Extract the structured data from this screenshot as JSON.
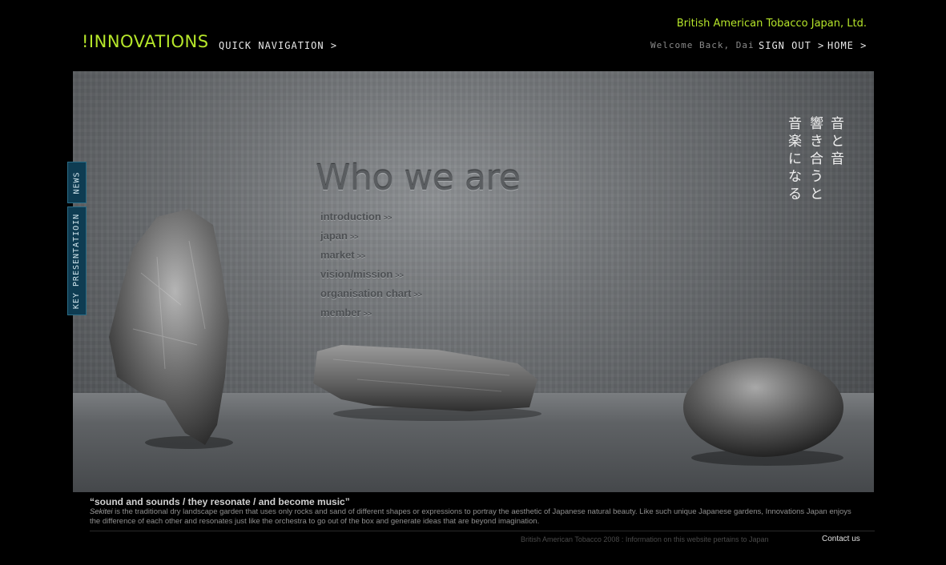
{
  "header": {
    "logo_bang": "!",
    "logo_text": "INNOVATIONS",
    "quick_nav": "QUICK NAVIGATION >",
    "company": "British American Tobacco Japan, Ltd.",
    "welcome": "Welcome Back, Dai",
    "sign_out": "SIGN OUT >",
    "home": "HOME >"
  },
  "hero": {
    "title": "Who we are",
    "menu": [
      {
        "label": "introduction",
        "arrow": ">>"
      },
      {
        "label": "japan",
        "arrow": ">>"
      },
      {
        "label": "market",
        "arrow": ">>"
      },
      {
        "label": "vision/mission",
        "arrow": ">>"
      },
      {
        "label": "organisation chart",
        "arrow": ">>"
      },
      {
        "label": "member",
        "arrow": ">>"
      }
    ],
    "jp_col1": "音と音",
    "jp_col2": "響き合うと",
    "jp_col3": "音楽になる"
  },
  "side_tabs": {
    "news": "NEWS",
    "key_presentation": "KEY PRESENTATIOIN"
  },
  "footer": {
    "quote": "“sound and sounds / they resonate / and become music”",
    "desc_italic": "Sekitei",
    "desc_rest": " is the traditional dry landscape garden that uses only rocks and sand of different shapes or expressions to portray the aesthetic of Japanese natural beauty. Like such unique Japanese gardens, Innovations Japan enjoys the difference of each other and resonates just like the orchestra to go out of the box and generate ideas that are beyond imagination.",
    "copyright": "British American Tobacco 2008 : Information on this website pertains to Japan",
    "contact": "Contact us"
  },
  "colors": {
    "accent": "#b6e62a",
    "tab_bg": "#0e3c52"
  }
}
